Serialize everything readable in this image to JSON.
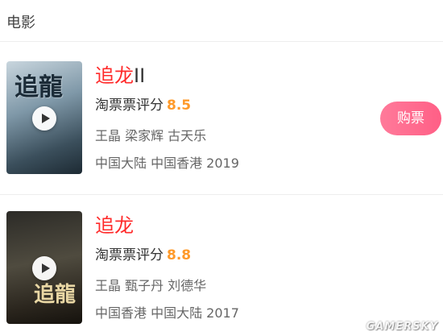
{
  "section": {
    "title": "电影"
  },
  "movies": [
    {
      "title": "追龙",
      "title_suffix": "II",
      "rating_label": "淘票票评分",
      "rating_score": "8.5",
      "cast": "王晶  梁家辉  古天乐",
      "meta": "中国大陆  中国香港  2019",
      "buy_label": "购票",
      "poster_title": "追龍"
    },
    {
      "title": "追龙",
      "title_suffix": "",
      "rating_label": "淘票票评分",
      "rating_score": "8.8",
      "cast": "王晶  甄子丹  刘德华",
      "meta": "中国香港  中国大陆  2017",
      "poster_title": "追龍"
    }
  ],
  "watermark": "GAMERSKY",
  "colors": {
    "title": "#ff2a2a",
    "score": "#ff9a2a",
    "buy_button": "#ff6a8e"
  }
}
